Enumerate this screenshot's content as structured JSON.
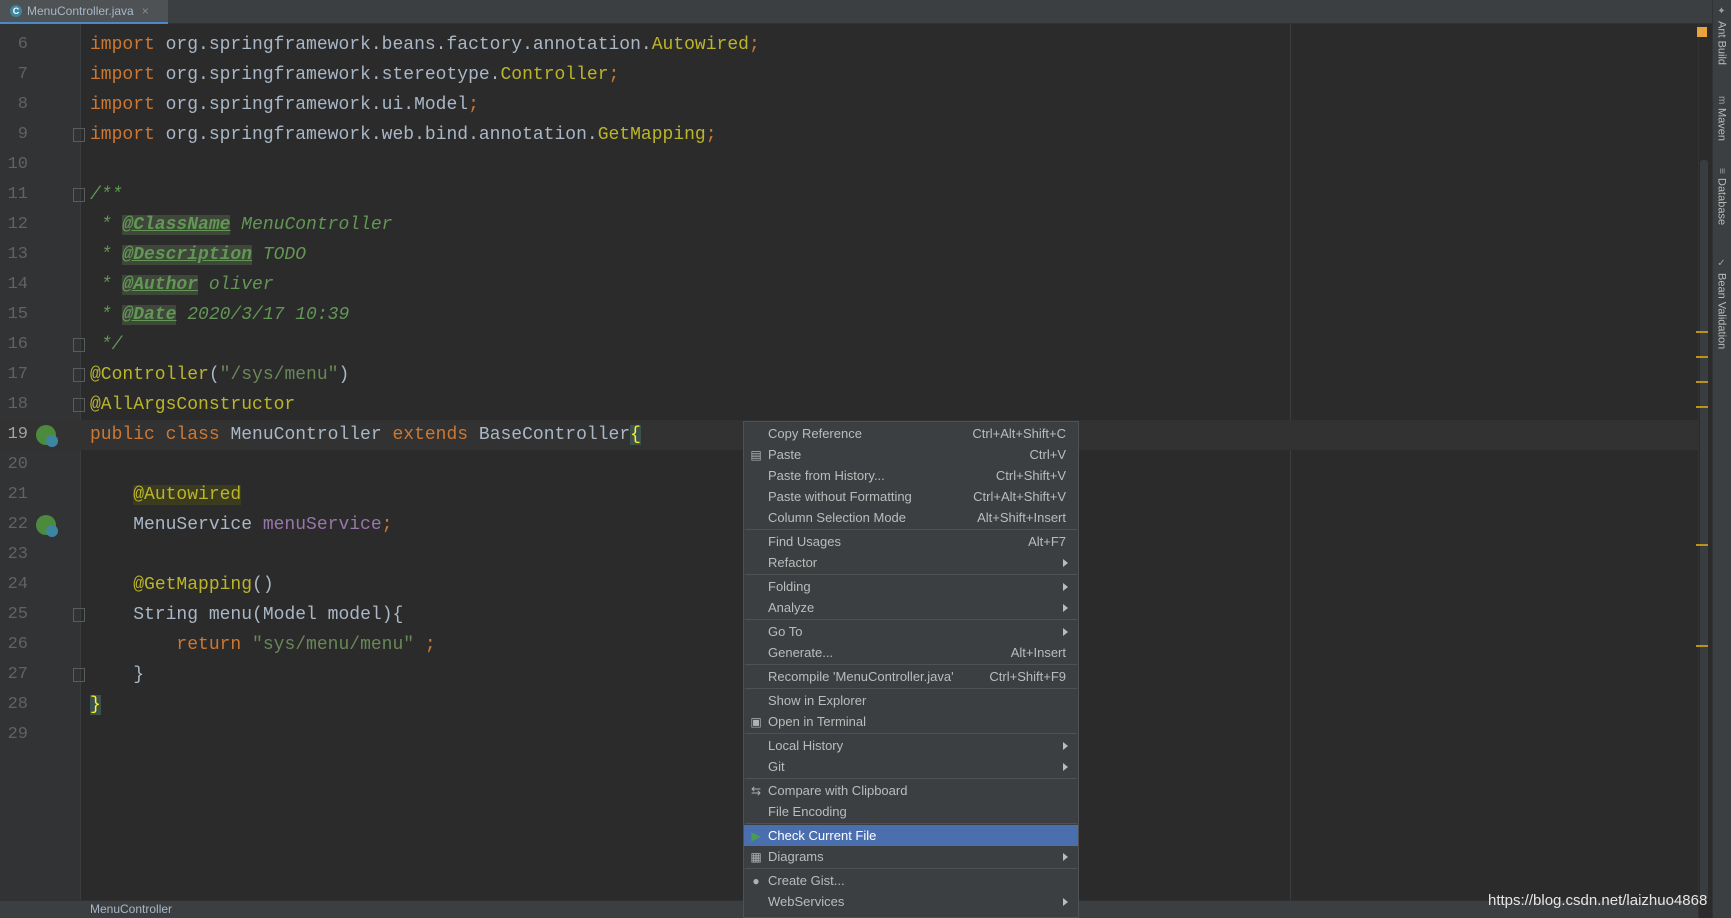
{
  "tab": {
    "filename": "MenuController.java",
    "close": "×",
    "icon_letter": "C"
  },
  "editor": {
    "lines": [
      {
        "num": "6",
        "tokens": [
          [
            "kw",
            "import "
          ],
          [
            "cls",
            "org.springframework.beans.factory.annotation."
          ],
          [
            "yel",
            "Autowired"
          ],
          [
            "kw",
            ";"
          ]
        ]
      },
      {
        "num": "7",
        "tokens": [
          [
            "kw",
            "import "
          ],
          [
            "cls",
            "org.springframework.stereotype."
          ],
          [
            "yel",
            "Controller"
          ],
          [
            "kw",
            ";"
          ]
        ]
      },
      {
        "num": "8",
        "tokens": [
          [
            "kw",
            "import "
          ],
          [
            "cls",
            "org.springframework.ui.Model"
          ],
          [
            "kw",
            ";"
          ]
        ]
      },
      {
        "num": "9",
        "tokens": [
          [
            "kw",
            "import "
          ],
          [
            "cls",
            "org.springframework.web.bind.annotation."
          ],
          [
            "yel",
            "GetMapping"
          ],
          [
            "kw",
            ";"
          ]
        ]
      },
      {
        "num": "10",
        "tokens": []
      },
      {
        "num": "11",
        "tokens": [
          [
            "doc",
            "/**"
          ]
        ]
      },
      {
        "num": "12",
        "tokens": [
          [
            "doc",
            " * "
          ],
          [
            "doctag",
            "@ClassName"
          ],
          [
            "doc",
            " MenuController"
          ]
        ]
      },
      {
        "num": "13",
        "tokens": [
          [
            "doc",
            " * "
          ],
          [
            "doctag",
            "@Description"
          ],
          [
            "doc",
            " TODO"
          ]
        ]
      },
      {
        "num": "14",
        "tokens": [
          [
            "doc",
            " * "
          ],
          [
            "doctag",
            "@Author"
          ],
          [
            "doc",
            " oliver"
          ]
        ]
      },
      {
        "num": "15",
        "tokens": [
          [
            "doc",
            " * "
          ],
          [
            "doctag",
            "@Date"
          ],
          [
            "doc",
            " 2020/3/17 10:39"
          ]
        ]
      },
      {
        "num": "16",
        "tokens": [
          [
            "doc",
            " */"
          ]
        ]
      },
      {
        "num": "17",
        "tokens": [
          [
            "ann",
            "@Controller"
          ],
          [
            "cls",
            "("
          ],
          [
            "str",
            "\"/sys/menu\""
          ],
          [
            "cls",
            ")"
          ]
        ]
      },
      {
        "num": "18",
        "tokens": [
          [
            "ann",
            "@AllArgsConstructor"
          ]
        ]
      },
      {
        "num": "19",
        "tokens": [
          [
            "kw",
            "public class "
          ],
          [
            "cls",
            "MenuController "
          ],
          [
            "kw",
            "extends "
          ],
          [
            "cls",
            "BaseController"
          ],
          [
            "brace-hl",
            "{"
          ]
        ]
      },
      {
        "num": "20",
        "tokens": []
      },
      {
        "num": "21",
        "tokens": [
          [
            "cls",
            "    "
          ],
          [
            "anhl ann",
            "@Autowired"
          ]
        ]
      },
      {
        "num": "22",
        "tokens": [
          [
            "cls",
            "    MenuService "
          ],
          [
            "field",
            "menuService"
          ],
          [
            "kw",
            ";"
          ]
        ]
      },
      {
        "num": "23",
        "tokens": []
      },
      {
        "num": "24",
        "tokens": [
          [
            "cls",
            "    "
          ],
          [
            "ann",
            "@GetMapping"
          ],
          [
            "cls",
            "()"
          ]
        ]
      },
      {
        "num": "25",
        "tokens": [
          [
            "cls",
            "    String "
          ],
          [
            "cls",
            "menu"
          ],
          [
            "cls",
            "(Model "
          ],
          [
            "cls",
            "model"
          ],
          [
            "cls",
            ")"
          ],
          [
            "cls",
            "{"
          ]
        ]
      },
      {
        "num": "26",
        "tokens": [
          [
            "cls",
            "        "
          ],
          [
            "kw",
            "return "
          ],
          [
            "str",
            "\"sys/menu/menu\""
          ],
          [
            "kw",
            " ;"
          ]
        ]
      },
      {
        "num": "27",
        "tokens": [
          [
            "cls",
            "    }"
          ]
        ]
      },
      {
        "num": "28",
        "tokens": [
          [
            "brace-hl",
            "}"
          ]
        ]
      },
      {
        "num": "29",
        "tokens": []
      }
    ],
    "current_line": "19"
  },
  "breadcrumb": {
    "text": "MenuController"
  },
  "toolwindows": [
    {
      "label": "Ant Build",
      "icon": "ant-icon"
    },
    {
      "label": "Maven",
      "icon": "maven-icon"
    },
    {
      "label": "Database",
      "icon": "database-icon"
    },
    {
      "label": "Bean Validation",
      "icon": "bean-validation-icon"
    }
  ],
  "context_menu": {
    "items": [
      {
        "label": "Copy Reference",
        "shortcut": "Ctrl+Alt+Shift+C"
      },
      {
        "label": "Paste",
        "shortcut": "Ctrl+V",
        "icon": "paste-icon"
      },
      {
        "label": "Paste from History...",
        "shortcut": "Ctrl+Shift+V"
      },
      {
        "label": "Paste without Formatting",
        "shortcut": "Ctrl+Alt+Shift+V"
      },
      {
        "label": "Column Selection Mode",
        "shortcut": "Alt+Shift+Insert"
      },
      {
        "label": "Find Usages",
        "shortcut": "Alt+F7"
      },
      {
        "label": "Refactor",
        "submenu": true
      },
      {
        "label": "Folding",
        "submenu": true
      },
      {
        "label": "Analyze",
        "submenu": true
      },
      {
        "label": "Go To",
        "submenu": true
      },
      {
        "label": "Generate...",
        "shortcut": "Alt+Insert"
      },
      {
        "label": "Recompile 'MenuController.java'",
        "shortcut": "Ctrl+Shift+F9"
      },
      {
        "label": "Show in Explorer"
      },
      {
        "label": "Open in Terminal",
        "icon": "terminal-icon"
      },
      {
        "label": "Local History",
        "submenu": true
      },
      {
        "label": "Git",
        "submenu": true
      },
      {
        "label": "Compare with Clipboard",
        "icon": "compare-icon"
      },
      {
        "label": "File Encoding"
      },
      {
        "label": "Check Current File",
        "icon": "run-icon",
        "selected": true
      },
      {
        "label": "Diagrams",
        "submenu": true,
        "icon": "diagram-icon"
      },
      {
        "label": "Create Gist...",
        "icon": "github-icon"
      },
      {
        "label": "WebServices",
        "submenu": true
      }
    ]
  },
  "watermark": "https://blog.csdn.net/laizhuo4868",
  "colors": {
    "background": "#2b2b2b",
    "keyword": "#cc7832",
    "annotation": "#bbb529",
    "doc": "#629755",
    "string": "#6a8759",
    "selection": "#4b6eaf"
  }
}
